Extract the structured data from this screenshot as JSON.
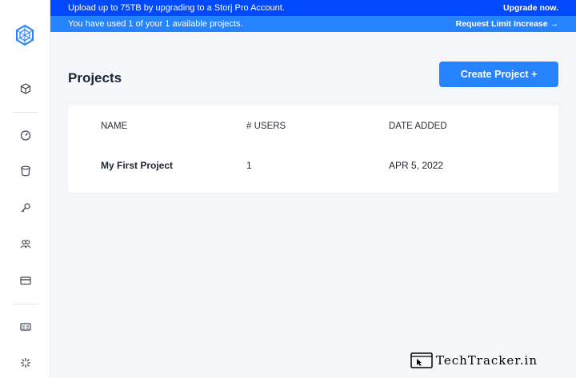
{
  "banners": {
    "upgrade": {
      "message": "Upload up to 75TB by upgrading to a Storj Pro Account.",
      "action": "Upgrade now."
    },
    "limit": {
      "message": "You have used 1 of your 1 available projects.",
      "action": "Request Limit Increase →"
    }
  },
  "sidebar": {
    "items": [
      {
        "icon": "cube-icon"
      },
      {
        "icon": "dashboard-gauge-icon"
      },
      {
        "icon": "bucket-icon"
      },
      {
        "icon": "key-icon"
      },
      {
        "icon": "users-icon"
      },
      {
        "icon": "credit-card-icon"
      },
      {
        "icon": "resources-icon"
      },
      {
        "icon": "settings-icon"
      }
    ]
  },
  "header": {
    "title": "Projects",
    "create_button": "Create Project +"
  },
  "table": {
    "columns": [
      "NAME",
      "# USERS",
      "DATE ADDED"
    ],
    "rows": [
      {
        "name": "My First Project",
        "users": "1",
        "date_added": "APR 5, 2022"
      }
    ]
  },
  "watermark": {
    "text": "TechTracker.in"
  },
  "colors": {
    "primary": "#2683ff",
    "banner_dark": "#0149ff",
    "background": "#f4f6fa"
  }
}
